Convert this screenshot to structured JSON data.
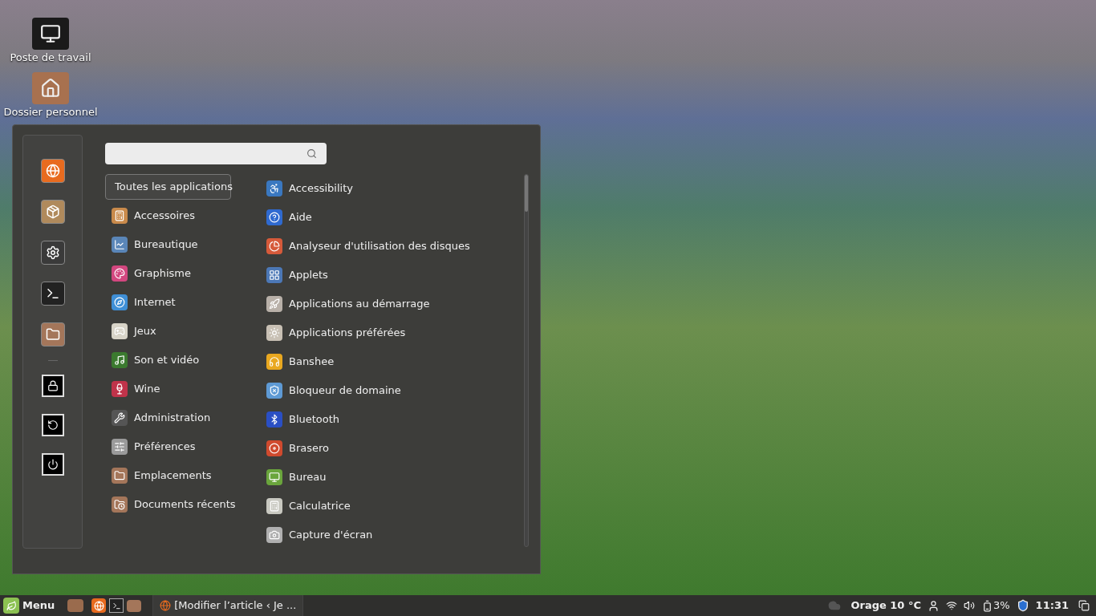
{
  "desktop_icons": [
    {
      "label": "Poste de travail",
      "kind": "computer"
    },
    {
      "label": "Dossier personnel",
      "kind": "home"
    }
  ],
  "menu": {
    "categories": [
      {
        "label": "Toutes les applications",
        "selected": true
      },
      {
        "label": "Accessoires",
        "selected": false
      },
      {
        "label": "Bureautique",
        "selected": false
      },
      {
        "label": "Graphisme",
        "selected": false
      },
      {
        "label": "Internet",
        "selected": false
      },
      {
        "label": "Jeux",
        "selected": false
      },
      {
        "label": "Son et vidéo",
        "selected": false
      },
      {
        "label": "Wine",
        "selected": false
      },
      {
        "label": "Administration",
        "selected": false
      },
      {
        "label": "Préférences",
        "selected": false
      },
      {
        "label": "Emplacements",
        "selected": false
      },
      {
        "label": "Documents récents",
        "selected": false
      }
    ],
    "applications": [
      "Accessibility",
      "Aide",
      "Analyseur d'utilisation des disques",
      "Applets",
      "Applications au démarrage",
      "Applications préférées",
      "Banshee",
      "Bloqueur de domaine",
      "Bluetooth",
      "Brasero",
      "Bureau",
      "Calculatrice",
      "Capture d'écran"
    ]
  },
  "taskbar": {
    "menu_label": "Menu",
    "window_title": "[Modifier l’article ‹ Je ...",
    "weather": "Orage 10 °C",
    "battery": "3%",
    "clock": "11:31"
  }
}
